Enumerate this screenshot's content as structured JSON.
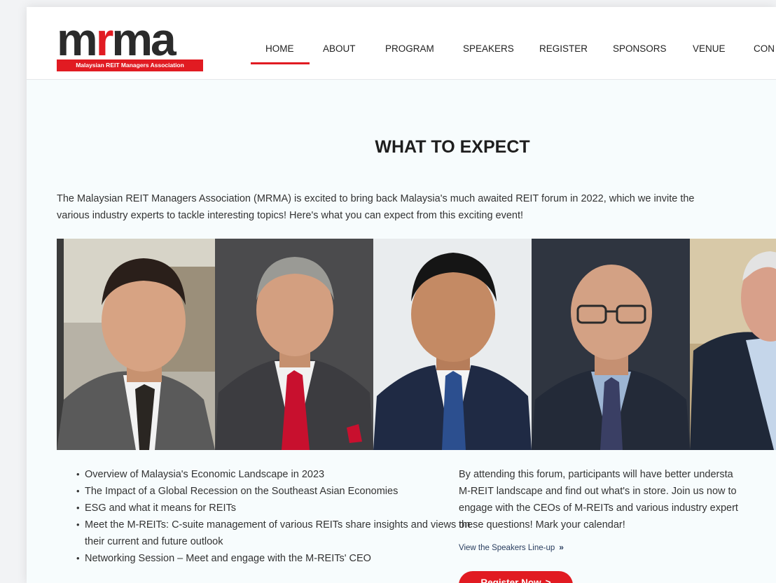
{
  "logo": {
    "word_start": "m",
    "word_accent": "r",
    "word_end": "ma",
    "tagline": "Malaysian REIT Managers Association"
  },
  "nav": {
    "items": [
      "HOME",
      "ABOUT",
      "PROGRAM",
      "SPEAKERS",
      "REGISTER",
      "SPONSORS",
      "VENUE",
      "CON"
    ],
    "active": "HOME"
  },
  "main": {
    "heading": "WHAT TO EXPECT",
    "intro_line1": "The Malaysian REIT Managers Association (MRMA) is excited to bring back Malaysia's much awaited REIT forum in 2022, which we invite the",
    "intro_line2": "various industry experts to tackle interesting topics! Here's what you can expect from this exciting event!",
    "bullets": [
      "Overview of Malaysia's Economic Landscape in 2023",
      "The Impact of a Global Recession on the Southeast Asian Economies",
      "ESG and what it means for REITs",
      "Meet the M-REITs: C-suite management of various REITs share insights and views on their current and future outlook",
      "Networking Session – Meet and engage with the M-REITs' CEO"
    ],
    "side_line1": "By attending this forum, participants will have better understa",
    "side_line2": "M-REIT landscape and find out what's in store. Join us now to",
    "side_line3": "engage with the CEOs of M-REITs and various industry expert",
    "side_line4": "these questions! Mark your calendar!",
    "speakers_link": "View the Speakers Line-up",
    "speakers_link_icon": "»",
    "register_button": "Register Now",
    "register_button_icon": ">"
  },
  "colors": {
    "accent": "#e11b22",
    "text": "#333333",
    "heading": "#1e1e1e",
    "page_bg": "#f7fcfd"
  }
}
